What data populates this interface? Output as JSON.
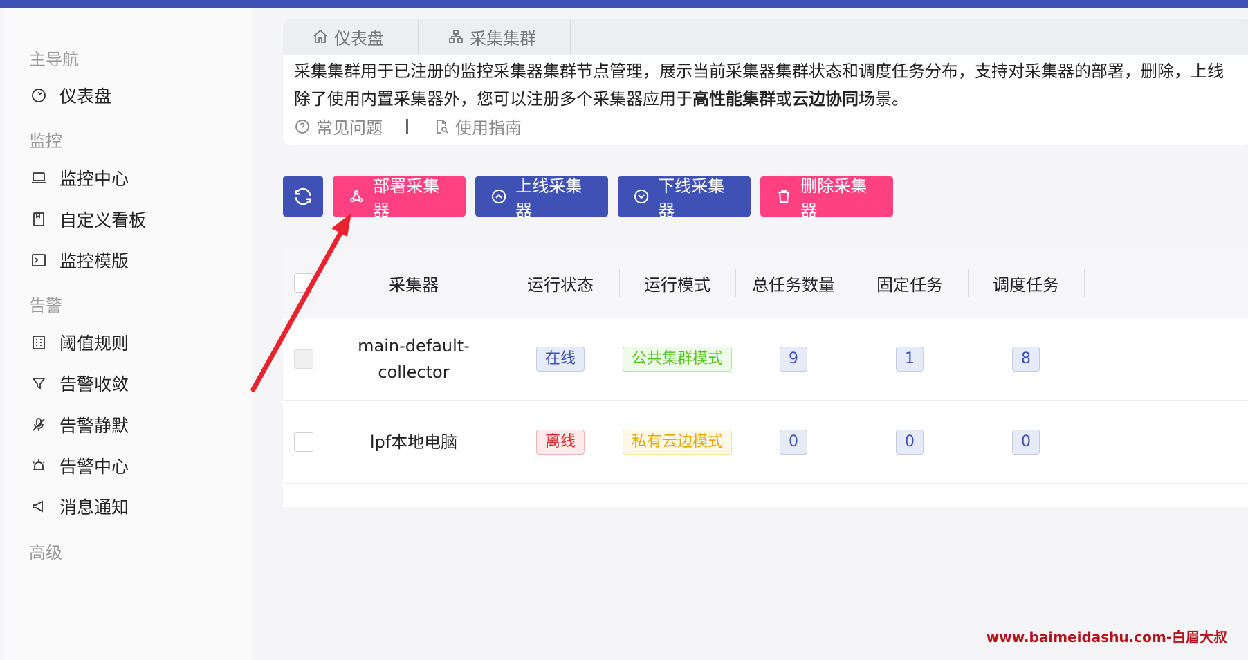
{
  "sidebar": {
    "groups": {
      "main_nav": "主导航",
      "monitor": "监控",
      "alert": "告警",
      "advanced": "高级"
    },
    "items": {
      "dashboard": "仪表盘",
      "monitor_center": "监控中心",
      "custom_board": "自定义看板",
      "monitor_template": "监控模版",
      "threshold_rules": "阈值规则",
      "alert_converge": "告警收敛",
      "alert_silence": "告警静默",
      "alert_center": "告警中心",
      "notice": "消息通知"
    }
  },
  "breadcrumb": {
    "tab1": "仪表盘",
    "tab2": "采集集群"
  },
  "description": {
    "line1": "采集集群用于已注册的监控采集器集群节点管理，展示当前采集器集群状态和调度任务分布，支持对采集器的部署，删除，上线",
    "line2_pre": "除了使用内置采集器外，您可以注册多个采集器应用于",
    "line2_b1": "高性能集群",
    "line2_mid": "或",
    "line2_b2": "云边协同",
    "line2_post": "场景。",
    "faq": "常见问题",
    "guide": "使用指南"
  },
  "toolbar": {
    "deploy": "部署采集器",
    "online": "上线采集器",
    "offline": "下线采集器",
    "delete": "删除采集器"
  },
  "table": {
    "headers": {
      "collector": "采集器",
      "status": "运行状态",
      "mode": "运行模式",
      "total": "总任务数量",
      "fixed": "固定任务",
      "dispatch": "调度任务"
    },
    "rows": [
      {
        "name_line1": "main-default-",
        "name_line2": "collector",
        "status": "在线",
        "mode": "公共集群模式",
        "total": "9",
        "fixed": "1",
        "dispatch": "8"
      },
      {
        "name_line1": "lpf本地电脑",
        "name_line2": "",
        "status": "离线",
        "mode": "私有云边模式",
        "total": "0",
        "fixed": "0",
        "dispatch": "0"
      }
    ]
  },
  "watermark": "www.baimeidashu.com-白眉大叔",
  "colors": {
    "primary": "#3f51b5",
    "accent": "#ff4081",
    "annotation": "#e8232e"
  }
}
